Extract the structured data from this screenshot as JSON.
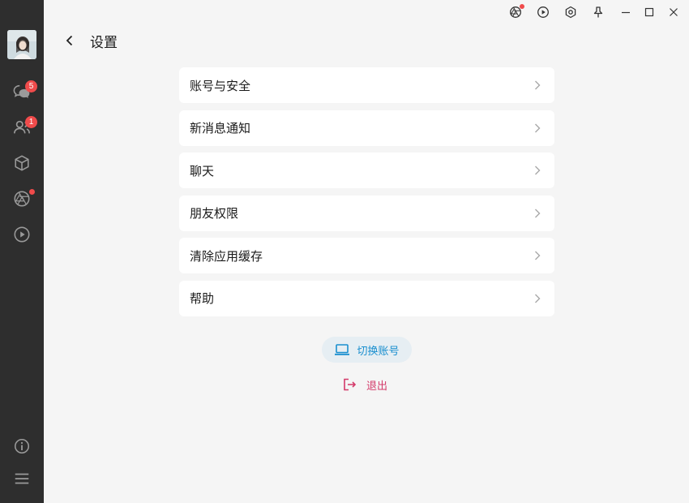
{
  "header": {
    "title": "设置"
  },
  "sidebar": {
    "chat_badge": "5",
    "contacts_badge": "1"
  },
  "settings": {
    "items": [
      {
        "label": "账号与安全"
      },
      {
        "label": "新消息通知"
      },
      {
        "label": "聊天"
      },
      {
        "label": "朋友权限"
      },
      {
        "label": "清除应用缓存"
      },
      {
        "label": "帮助"
      }
    ]
  },
  "actions": {
    "switch_account_label": "切换账号",
    "logout_label": "退出"
  },
  "colors": {
    "sidebar_bg": "#2e2e2e",
    "badge": "#f04b4b",
    "switch_accent": "#1a8fcf",
    "logout_accent": "#d43a6a"
  },
  "icons": {
    "sidebar": [
      "chat-icon",
      "contacts-icon",
      "cube-icon",
      "aperture-icon",
      "play-circle-icon",
      "info-icon",
      "menu-icon"
    ],
    "titlebar": [
      "moments-icon",
      "play-icon",
      "settings-icon",
      "pin-icon",
      "minimize-icon",
      "maximize-icon",
      "close-icon"
    ]
  }
}
